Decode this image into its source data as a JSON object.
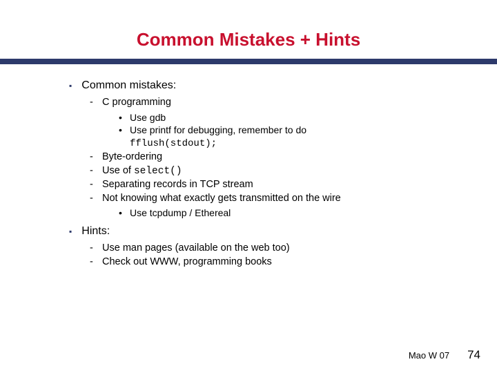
{
  "title": "Common Mistakes + Hints",
  "sections": [
    {
      "title": "Common mistakes:",
      "items": [
        {
          "text": "C programming",
          "sub": [
            {
              "text": "Use gdb"
            },
            {
              "text": "Use printf for debugging, remember to do",
              "code_after": "fflush(stdout);"
            }
          ]
        },
        {
          "text": "Byte-ordering"
        },
        {
          "pre": "Use of ",
          "code": "select()"
        },
        {
          "text": "Separating records in TCP stream"
        },
        {
          "text": "Not knowing what exactly gets transmitted on the wire",
          "sub": [
            {
              "text": "Use tcpdump / Ethereal"
            }
          ]
        }
      ]
    },
    {
      "title": "Hints:",
      "items": [
        {
          "text": "Use man pages (available on the web too)"
        },
        {
          "text": "Check out WWW, programming books"
        }
      ]
    }
  ],
  "footer": {
    "author": "Mao W 07",
    "page": "74"
  }
}
